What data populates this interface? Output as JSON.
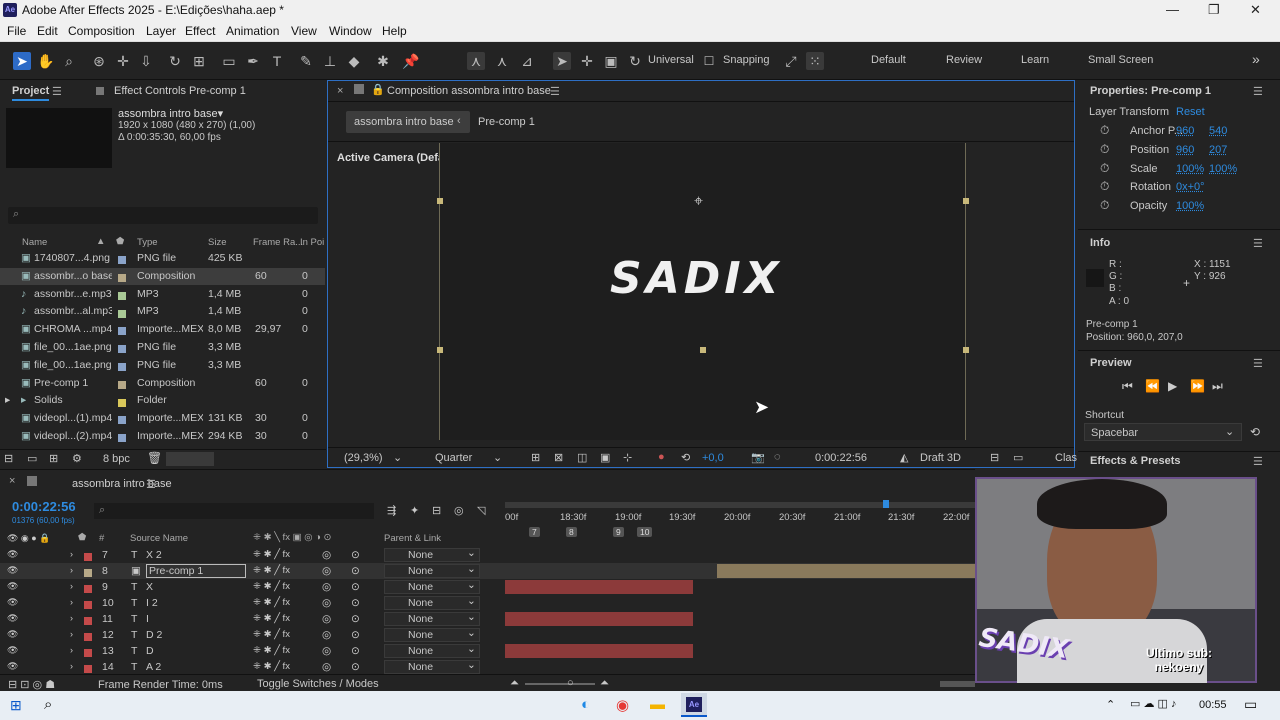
{
  "app": {
    "title": "Adobe After Effects 2025 - E:\\Edições\\haha.aep *",
    "icon_label": "Ae"
  },
  "window_controls": {
    "minimize": "—",
    "maximize": "❐",
    "close": "✕"
  },
  "menu": [
    "File",
    "Edit",
    "Composition",
    "Layer",
    "Effect",
    "Animation",
    "View",
    "Window",
    "Help"
  ],
  "toolbar": {
    "axis_mode": "Universal",
    "snapping": "Snapping",
    "workspaces": [
      "Default",
      "Review",
      "Learn",
      "Small Screen"
    ],
    "more": "»"
  },
  "project": {
    "tab": "Project",
    "effect_controls_tab": "Effect Controls Pre-comp 1",
    "selected_name": "assombra intro base▾",
    "selected_info1": "1920 x 1080  (480 x 270) (1,00)",
    "selected_info2": "Δ 0:00:35:30, 60,00 fps",
    "search_placeholder": "⌕",
    "columns": {
      "name": "Name",
      "type": "Type",
      "size": "Size",
      "frame_rate": "Frame Ra...",
      "in_point": "In Poi"
    },
    "items": [
      {
        "name": "1740807...4.png",
        "type": "PNG file",
        "size": "425 KB",
        "fr": "",
        "inp": "",
        "color": "#8aa3c9",
        "icon": "▣"
      },
      {
        "name": "assombr...o base",
        "type": "Composition",
        "size": "",
        "fr": "60",
        "inp": "0",
        "color": "#b7a988",
        "icon": "▣"
      },
      {
        "name": "assombr...e.mp3",
        "type": "MP3",
        "size": "1,4 MB",
        "fr": "",
        "inp": "0",
        "color": "#a9c996",
        "icon": "♪"
      },
      {
        "name": "assombr...al.mp3",
        "type": "MP3",
        "size": "1,4 MB",
        "fr": "",
        "inp": "0",
        "color": "#a9c996",
        "icon": "♪"
      },
      {
        "name": "CHROMA ...mp4",
        "type": "Importe...MEX",
        "size": "8,0 MB",
        "fr": "29,97",
        "inp": "0",
        "color": "#8aa3c9",
        "icon": "▣"
      },
      {
        "name": "file_00...1ae.png",
        "type": "PNG file",
        "size": "3,3 MB",
        "fr": "",
        "inp": "",
        "color": "#8aa3c9",
        "icon": "▣"
      },
      {
        "name": "file_00...1ae.png",
        "type": "PNG file",
        "size": "3,3 MB",
        "fr": "",
        "inp": "",
        "color": "#8aa3c9",
        "icon": "▣"
      },
      {
        "name": "Pre-comp 1",
        "type": "Composition",
        "size": "",
        "fr": "60",
        "inp": "0",
        "color": "#b7a988",
        "icon": "▣"
      },
      {
        "name": "Solids",
        "type": "Folder",
        "size": "",
        "fr": "",
        "inp": "",
        "color": "#d9c85a",
        "icon": "▸"
      },
      {
        "name": "videopl...(1).mp4",
        "type": "Importe...MEX",
        "size": "131 KB",
        "fr": "30",
        "inp": "0",
        "color": "#8aa3c9",
        "icon": "▣"
      },
      {
        "name": "videopl...(2).mp4",
        "type": "Importe...MEX",
        "size": "294 KB",
        "fr": "30",
        "inp": "0",
        "color": "#8aa3c9",
        "icon": "▣"
      }
    ],
    "bpc": "8 bpc"
  },
  "composition": {
    "tab": "Composition assombra intro base",
    "crumb_active": "assombra intro base",
    "crumb_next": "Pre-comp 1",
    "camera": "Active Camera (Default)",
    "canvas_text": "SADIX",
    "footer": {
      "zoom": "(29,3%)",
      "resolution": "Quarter",
      "exposure": "+0,0",
      "timecode": "0:00:22:56",
      "renderer": "Draft 3D",
      "classic": "Clas"
    }
  },
  "properties": {
    "title": "Properties: Pre-comp 1",
    "section": "Layer Transform",
    "reset": "Reset",
    "rows": [
      {
        "label": "Anchor P...",
        "v1": "960",
        "v2": "540"
      },
      {
        "label": "Position",
        "v1": "960",
        "v2": "207"
      },
      {
        "label": "Scale",
        "v1": "100%",
        "v2": "100%"
      },
      {
        "label": "Rotation",
        "v1": "0x+0°",
        "v2": ""
      },
      {
        "label": "Opacity",
        "v1": "100%",
        "v2": ""
      }
    ]
  },
  "info": {
    "title": "Info",
    "r": "R :",
    "g": "G :",
    "b": "B :",
    "a": "A :  0",
    "x": "X : 1151",
    "y": "Y : 926",
    "layer": "Pre-comp 1",
    "position": "Position: 960,0, 207,0"
  },
  "preview": {
    "title": "Preview",
    "shortcut_label": "Shortcut",
    "shortcut_value": "Spacebar",
    "effects_title": "Effects & Presets"
  },
  "timeline": {
    "tab": "assombra intro base",
    "timecode": "0:00:22:56",
    "frames": "01376 (60,00 fps)",
    "search_placeholder": "⌕",
    "col_num": "#",
    "col_source": "Source Name",
    "col_parent": "Parent & Link",
    "ruler": [
      "00f",
      "18:30f",
      "19:00f",
      "19:30f",
      "20:00f",
      "20:30f",
      "21:00f",
      "21:30f",
      "22:00f"
    ],
    "markers": [
      "7",
      "8",
      "9",
      "10"
    ],
    "layers": [
      {
        "num": "7",
        "name": "X 2",
        "parent": "None",
        "type": "T",
        "color": "#c44a4a",
        "bar_color": "",
        "bar_start": 0,
        "bar_end": 0
      },
      {
        "num": "8",
        "name": "Pre-comp 1",
        "parent": "None",
        "type": "▣",
        "color": "#b7a988",
        "bar_color": "#8a7a5c",
        "bar_start": 0.45,
        "bar_end": 1.0,
        "selected": true
      },
      {
        "num": "9",
        "name": "X",
        "parent": "None",
        "type": "T",
        "color": "#c44a4a",
        "bar_color": "#8c3a3a",
        "bar_start": 0,
        "bar_end": 0.4
      },
      {
        "num": "10",
        "name": "I 2",
        "parent": "None",
        "type": "T",
        "color": "#c44a4a",
        "bar_color": "",
        "bar_start": 0,
        "bar_end": 0
      },
      {
        "num": "11",
        "name": "I",
        "parent": "None",
        "type": "T",
        "color": "#c44a4a",
        "bar_color": "#8c3a3a",
        "bar_start": 0,
        "bar_end": 0.4
      },
      {
        "num": "12",
        "name": "D 2",
        "parent": "None",
        "type": "T",
        "color": "#c44a4a",
        "bar_color": "",
        "bar_start": 0,
        "bar_end": 0
      },
      {
        "num": "13",
        "name": "D",
        "parent": "None",
        "type": "T",
        "color": "#c44a4a",
        "bar_color": "#8c3a3a",
        "bar_start": 0,
        "bar_end": 0.4
      },
      {
        "num": "14",
        "name": "A 2",
        "parent": "None",
        "type": "T",
        "color": "#c44a4a",
        "bar_color": "",
        "bar_start": 0,
        "bar_end": 0
      }
    ],
    "frame_render": "Frame Render Time:  0ms",
    "toggle": "Toggle Switches / Modes"
  },
  "webcam": {
    "logo": "SADIX",
    "caption": "Ultimo sub:\nnekoeny"
  },
  "taskbar": {
    "time": "00:55"
  }
}
